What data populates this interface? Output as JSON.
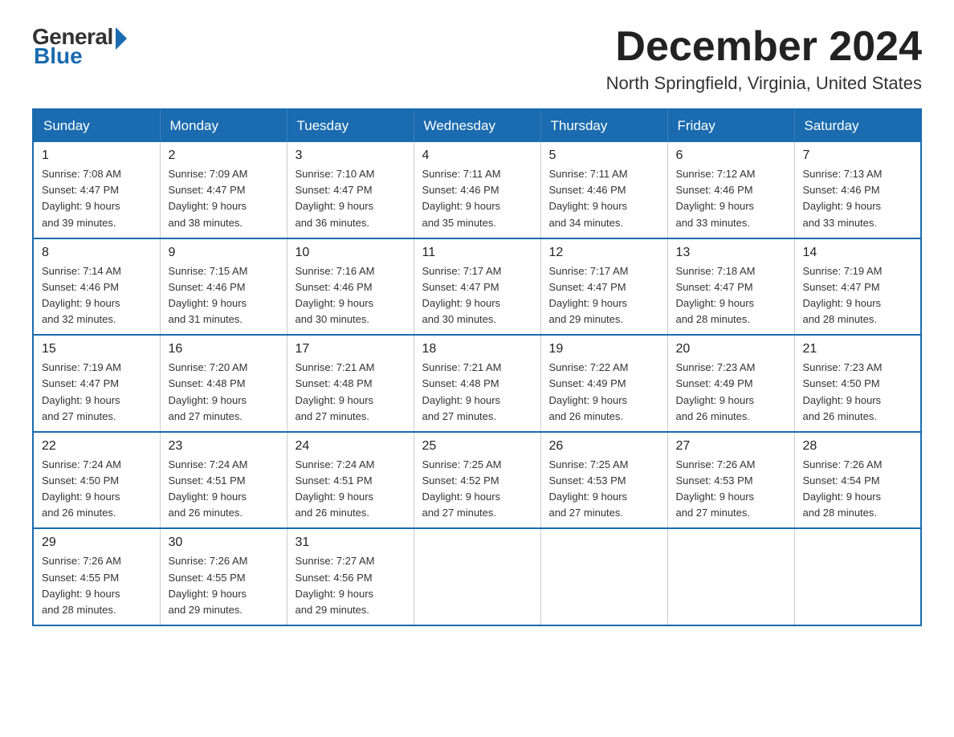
{
  "header": {
    "logo": {
      "general": "General",
      "blue": "Blue"
    },
    "title": "December 2024",
    "location": "North Springfield, Virginia, United States"
  },
  "days_of_week": [
    "Sunday",
    "Monday",
    "Tuesday",
    "Wednesday",
    "Thursday",
    "Friday",
    "Saturday"
  ],
  "weeks": [
    [
      {
        "day": "1",
        "sunrise": "7:08 AM",
        "sunset": "4:47 PM",
        "daylight": "9 hours and 39 minutes."
      },
      {
        "day": "2",
        "sunrise": "7:09 AM",
        "sunset": "4:47 PM",
        "daylight": "9 hours and 38 minutes."
      },
      {
        "day": "3",
        "sunrise": "7:10 AM",
        "sunset": "4:47 PM",
        "daylight": "9 hours and 36 minutes."
      },
      {
        "day": "4",
        "sunrise": "7:11 AM",
        "sunset": "4:46 PM",
        "daylight": "9 hours and 35 minutes."
      },
      {
        "day": "5",
        "sunrise": "7:11 AM",
        "sunset": "4:46 PM",
        "daylight": "9 hours and 34 minutes."
      },
      {
        "day": "6",
        "sunrise": "7:12 AM",
        "sunset": "4:46 PM",
        "daylight": "9 hours and 33 minutes."
      },
      {
        "day": "7",
        "sunrise": "7:13 AM",
        "sunset": "4:46 PM",
        "daylight": "9 hours and 33 minutes."
      }
    ],
    [
      {
        "day": "8",
        "sunrise": "7:14 AM",
        "sunset": "4:46 PM",
        "daylight": "9 hours and 32 minutes."
      },
      {
        "day": "9",
        "sunrise": "7:15 AM",
        "sunset": "4:46 PM",
        "daylight": "9 hours and 31 minutes."
      },
      {
        "day": "10",
        "sunrise": "7:16 AM",
        "sunset": "4:46 PM",
        "daylight": "9 hours and 30 minutes."
      },
      {
        "day": "11",
        "sunrise": "7:17 AM",
        "sunset": "4:47 PM",
        "daylight": "9 hours and 30 minutes."
      },
      {
        "day": "12",
        "sunrise": "7:17 AM",
        "sunset": "4:47 PM",
        "daylight": "9 hours and 29 minutes."
      },
      {
        "day": "13",
        "sunrise": "7:18 AM",
        "sunset": "4:47 PM",
        "daylight": "9 hours and 28 minutes."
      },
      {
        "day": "14",
        "sunrise": "7:19 AM",
        "sunset": "4:47 PM",
        "daylight": "9 hours and 28 minutes."
      }
    ],
    [
      {
        "day": "15",
        "sunrise": "7:19 AM",
        "sunset": "4:47 PM",
        "daylight": "9 hours and 27 minutes."
      },
      {
        "day": "16",
        "sunrise": "7:20 AM",
        "sunset": "4:48 PM",
        "daylight": "9 hours and 27 minutes."
      },
      {
        "day": "17",
        "sunrise": "7:21 AM",
        "sunset": "4:48 PM",
        "daylight": "9 hours and 27 minutes."
      },
      {
        "day": "18",
        "sunrise": "7:21 AM",
        "sunset": "4:48 PM",
        "daylight": "9 hours and 27 minutes."
      },
      {
        "day": "19",
        "sunrise": "7:22 AM",
        "sunset": "4:49 PM",
        "daylight": "9 hours and 26 minutes."
      },
      {
        "day": "20",
        "sunrise": "7:23 AM",
        "sunset": "4:49 PM",
        "daylight": "9 hours and 26 minutes."
      },
      {
        "day": "21",
        "sunrise": "7:23 AM",
        "sunset": "4:50 PM",
        "daylight": "9 hours and 26 minutes."
      }
    ],
    [
      {
        "day": "22",
        "sunrise": "7:24 AM",
        "sunset": "4:50 PM",
        "daylight": "9 hours and 26 minutes."
      },
      {
        "day": "23",
        "sunrise": "7:24 AM",
        "sunset": "4:51 PM",
        "daylight": "9 hours and 26 minutes."
      },
      {
        "day": "24",
        "sunrise": "7:24 AM",
        "sunset": "4:51 PM",
        "daylight": "9 hours and 26 minutes."
      },
      {
        "day": "25",
        "sunrise": "7:25 AM",
        "sunset": "4:52 PM",
        "daylight": "9 hours and 27 minutes."
      },
      {
        "day": "26",
        "sunrise": "7:25 AM",
        "sunset": "4:53 PM",
        "daylight": "9 hours and 27 minutes."
      },
      {
        "day": "27",
        "sunrise": "7:26 AM",
        "sunset": "4:53 PM",
        "daylight": "9 hours and 27 minutes."
      },
      {
        "day": "28",
        "sunrise": "7:26 AM",
        "sunset": "4:54 PM",
        "daylight": "9 hours and 28 minutes."
      }
    ],
    [
      {
        "day": "29",
        "sunrise": "7:26 AM",
        "sunset": "4:55 PM",
        "daylight": "9 hours and 28 minutes."
      },
      {
        "day": "30",
        "sunrise": "7:26 AM",
        "sunset": "4:55 PM",
        "daylight": "9 hours and 29 minutes."
      },
      {
        "day": "31",
        "sunrise": "7:27 AM",
        "sunset": "4:56 PM",
        "daylight": "9 hours and 29 minutes."
      },
      null,
      null,
      null,
      null
    ]
  ],
  "labels": {
    "sunrise": "Sunrise:",
    "sunset": "Sunset:",
    "daylight": "Daylight:"
  }
}
